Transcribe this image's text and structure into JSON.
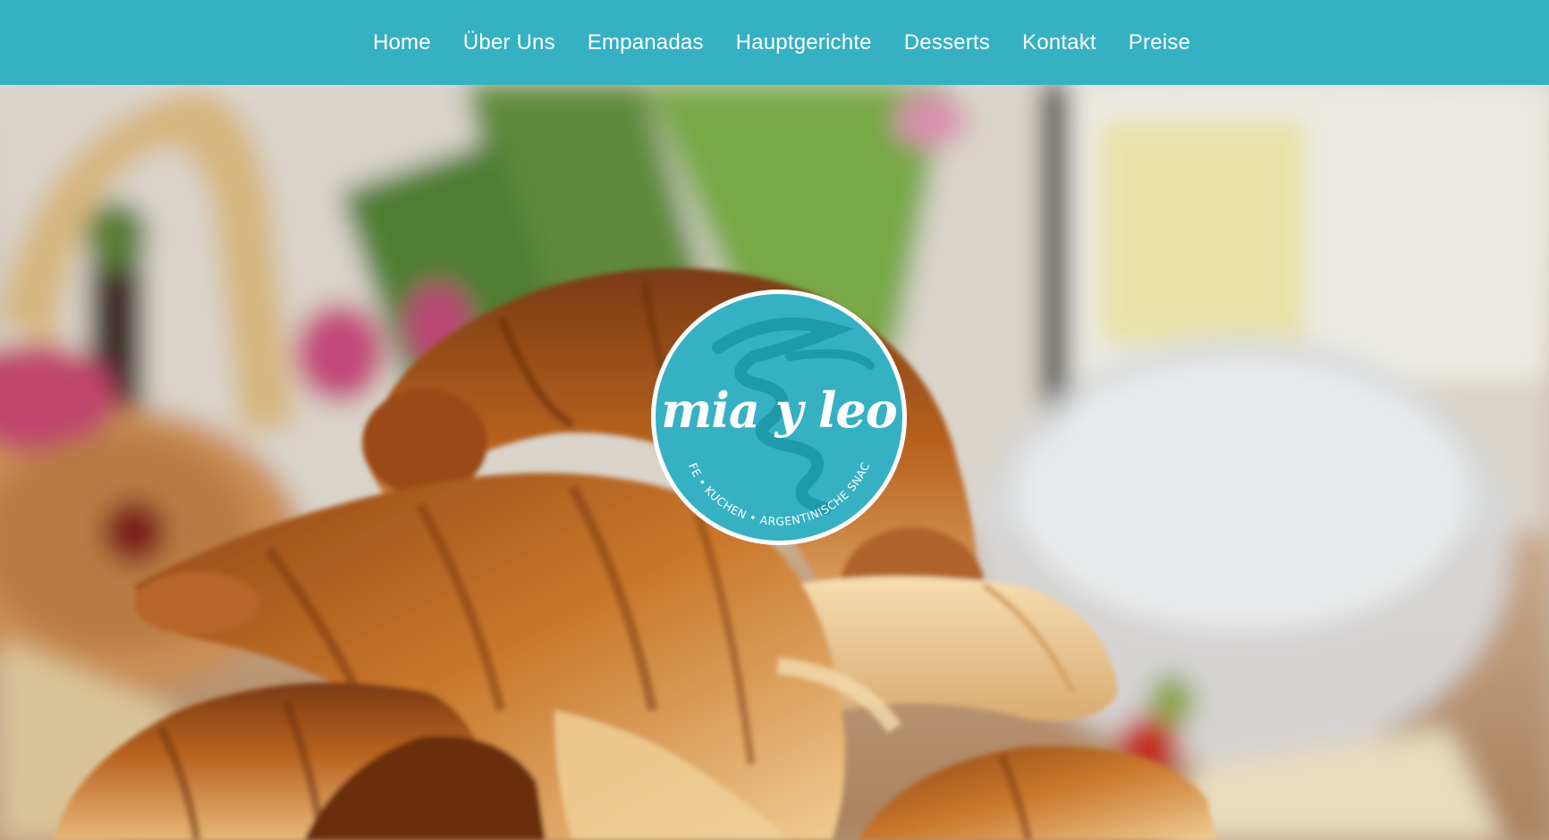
{
  "nav": {
    "items": [
      {
        "label": "Home"
      },
      {
        "label": "Über Uns"
      },
      {
        "label": "Empanadas"
      },
      {
        "label": "Hauptgerichte"
      },
      {
        "label": "Desserts"
      },
      {
        "label": "Kontakt"
      },
      {
        "label": "Preise"
      }
    ]
  },
  "logo": {
    "wordmark": "mia y leo",
    "tagline": "CAFE • KUCHEN • ARGENTINISCHE SNACKS"
  },
  "colors": {
    "brand": "#35b1c3",
    "nav_text": "#ffffff"
  },
  "hero": {
    "image": "croissants-on-table-photo"
  }
}
